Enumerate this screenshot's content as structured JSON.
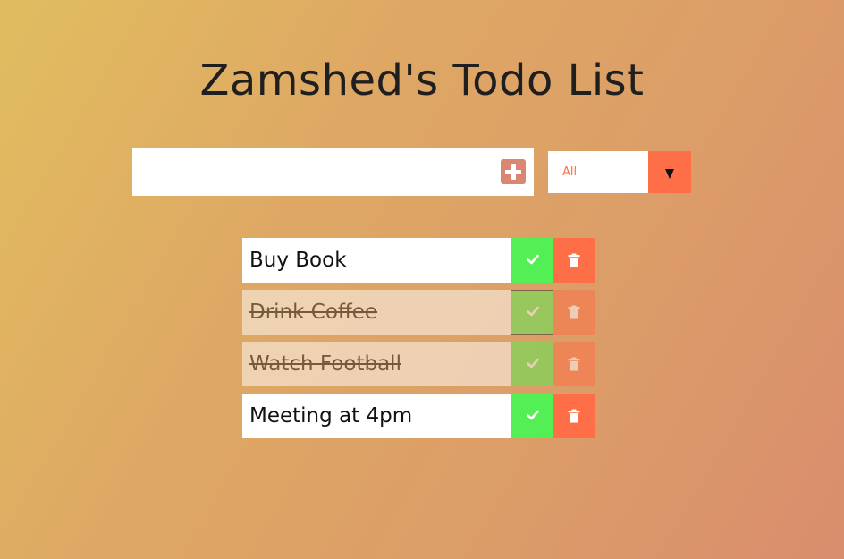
{
  "header": {
    "title": "Zamshed's Todo List"
  },
  "form": {
    "input_value": "",
    "input_placeholder": "",
    "add_icon": "plus-square-icon"
  },
  "filter": {
    "selected": "All",
    "arrow_icon": "triangle-down-icon"
  },
  "todos": [
    {
      "text": "Buy Book",
      "completed": false
    },
    {
      "text": "Drink Coffee",
      "completed": true
    },
    {
      "text": "Watch Football",
      "completed": true
    },
    {
      "text": "Meeting at 4pm",
      "completed": false
    }
  ],
  "icons": {
    "complete": "check-icon",
    "delete": "trash-icon"
  },
  "colors": {
    "background_start": "#e1bd5f",
    "background_end": "#d98d6d",
    "accent": "#ff6f47",
    "complete_green": "#54ef54",
    "add_button": "#d98672"
  }
}
